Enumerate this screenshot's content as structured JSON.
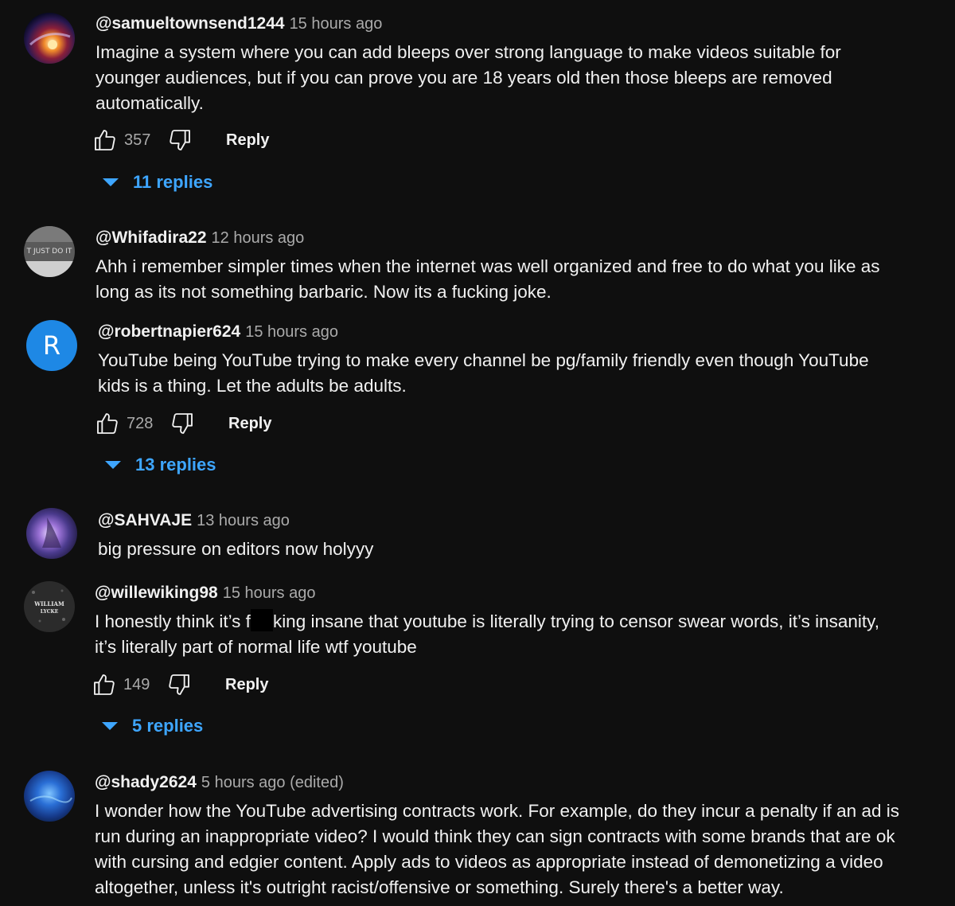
{
  "colors": {
    "background": "#0f0f0f",
    "text": "#f1f1f1",
    "secondary_text": "#aaaaaa",
    "link_blue": "#3ea6ff",
    "avatar_r": "#1e88e5"
  },
  "comments": [
    {
      "handle": "@samueltownsend1244",
      "time": "15 hours ago",
      "lines": [
        "Imagine a system where you can add bleeps over strong language to make videos suitable for",
        "younger audiences, but if you can prove you are 18 years old then those bleeps are removed",
        "automatically."
      ],
      "likes": "357",
      "reply_label": "Reply",
      "replies": "11 replies",
      "avatar_icon": "galaxy-avatar"
    },
    {
      "handle": "@Whifadira22",
      "time": "12 hours ago",
      "lines": [
        "Ahh i remember simpler times when the internet was well organized and free to do what you like as",
        "long as its not something barbaric. Now its a fucking joke."
      ],
      "avatar_icon": "meme-avatar",
      "avatar_text": "T JUST DO IT"
    },
    {
      "handle": "@robertnapier624",
      "time": "15 hours ago",
      "lines": [
        "YouTube being YouTube trying to make every channel be pg/family friendly even though YouTube",
        "kids is a thing. Let the adults be adults."
      ],
      "likes": "728",
      "reply_label": "Reply",
      "replies": "13 replies",
      "avatar_letter": "R"
    },
    {
      "handle": "@SAHVAJE",
      "time": "13 hours ago",
      "lines": [
        "big pressure on editors now holyyy"
      ],
      "avatar_icon": "nebula-avatar"
    },
    {
      "handle": "@willewiking98",
      "time": "15 hours ago",
      "line1_before": "I honestly think it’s f",
      "line1_after": "king insane that youtube is literally trying to censor swear words, it’s insanity,",
      "line2": "it’s literally part of normal life wtf youtube",
      "likes": "149",
      "reply_label": "Reply",
      "replies": "5 replies",
      "avatar_icon": "logo-avatar",
      "avatar_text_1": "WILLIAM",
      "avatar_text_2": "LYCKE"
    },
    {
      "handle": "@shady2624",
      "time": "5 hours ago (edited)",
      "lines": [
        "I wonder how the YouTube advertising contracts work. For example, do they incur a penalty if an ad is",
        "run during an inappropriate video? I would think they can sign contracts with some brands that are ok",
        "with cursing and edgier content. Apply ads to videos as appropriate instead of demonetizing a video",
        "altogether, unless it's outright racist/offensive or something. Surely there's a better way."
      ],
      "avatar_icon": "ocean-avatar"
    }
  ]
}
